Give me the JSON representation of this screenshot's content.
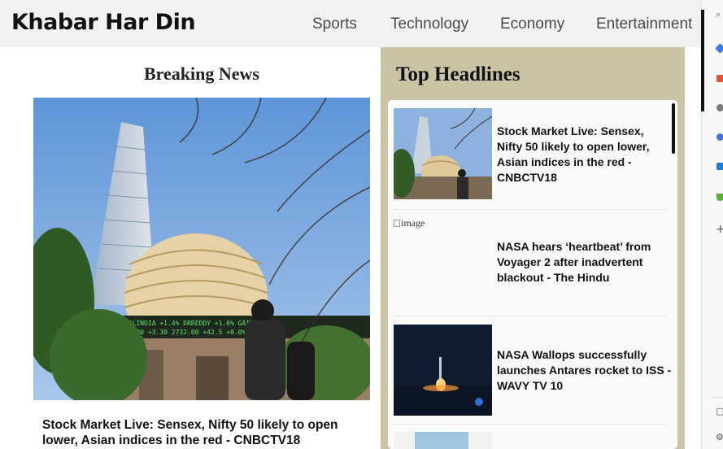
{
  "site": {
    "brand": "Khabar Har Din"
  },
  "nav": {
    "items": [
      "Sports",
      "Technology",
      "Economy",
      "Entertainment"
    ]
  },
  "breaking": {
    "title": "Breaking News",
    "caption": "Stock Market Live: Sensex, Nifty 50 likely to open lower, Asian indices in the red - CNBCTV18",
    "ticker_lines": [
      "SALINDIA +1.4%   DRREDDY +1.6%   GAIL  +0.0%",
      "12.90   +3.30   2732.00  +42.5   +0.0%"
    ]
  },
  "top_headlines": {
    "title": "Top Headlines",
    "items": [
      {
        "headline": "Stock Market Live: Sensex, Nifty 50 likely to open lower, Asian indices in the red - CNBCTV18",
        "thumb": "bse-building"
      },
      {
        "headline": "NASA hears ‘heartbeat’ from Voyager 2 after inadvertent blackout - The Hindu",
        "thumb": "broken",
        "alt": "image"
      },
      {
        "headline": "NASA Wallops successfully launches Antares rocket to ISS - WAVY TV 10",
        "thumb": "rocket-launch"
      }
    ]
  },
  "colors": {
    "panel": "#cbc4a4",
    "header": "#f2f2f2",
    "nav_text": "#4a4a4a"
  },
  "sidebar": {
    "icons": [
      "search-icon",
      "copilot-icon",
      "shopping-icon",
      "people-icon",
      "circle-icon",
      "office-icon",
      "drive-icon",
      "add-icon",
      "panel-icon",
      "settings-icon"
    ]
  }
}
